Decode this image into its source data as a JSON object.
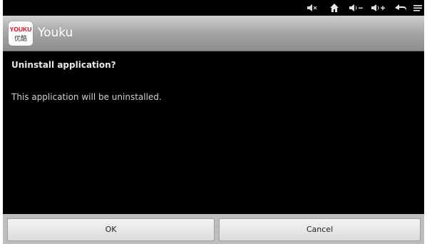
{
  "status_bar": {
    "icons": [
      "mute-icon",
      "home-icon",
      "volume-down-icon",
      "volume-up-icon",
      "back-icon",
      "menu-icon"
    ]
  },
  "app": {
    "icon_logo_text": "YOUKU",
    "icon_logo_subtext": "优酷",
    "title": "Youku"
  },
  "dialog": {
    "heading": "Uninstall application?",
    "message": "This application will be uninstalled."
  },
  "buttons": {
    "ok": "OK",
    "cancel": "Cancel"
  },
  "colors": {
    "background": "#000000",
    "title_bar": "#a7a7a7",
    "button_bar": "#bdbdbd",
    "logo_red": "#e60012",
    "logo_blue": "#1d74c4"
  }
}
